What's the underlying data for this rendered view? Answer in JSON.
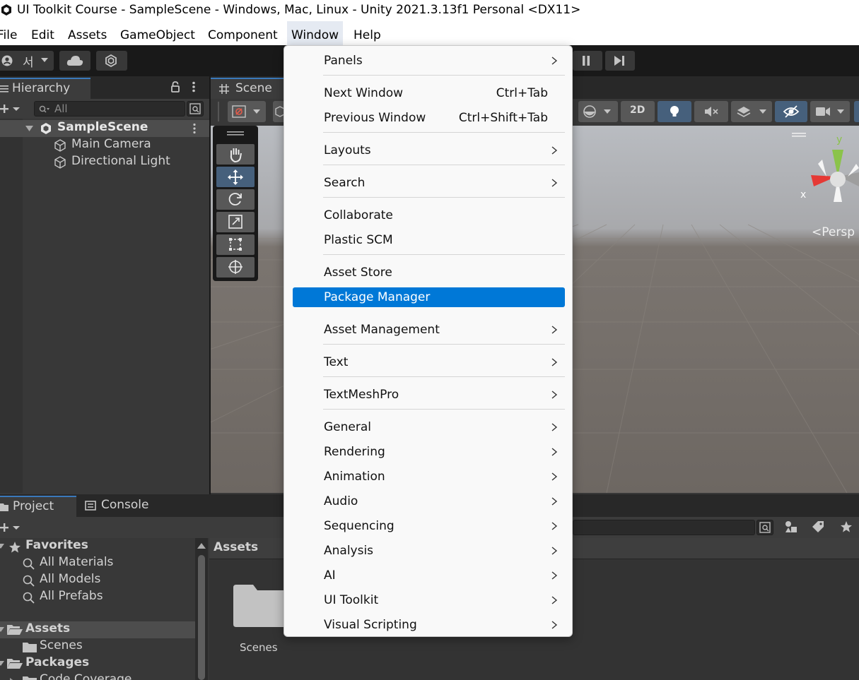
{
  "window": {
    "title": "UI Toolkit Course - SampleScene - Windows, Mac, Linux - Unity 2021.3.13f1 Personal <DX11>"
  },
  "menubar": {
    "items": [
      "File",
      "Edit",
      "Assets",
      "GameObject",
      "Component",
      "Window",
      "Help"
    ]
  },
  "toolbar": {
    "account_label": "서"
  },
  "hierarchy": {
    "tab_label": "Hierarchy",
    "search_placeholder": "All",
    "scene": "SampleScene",
    "objects": [
      "Main Camera",
      "Directional Light"
    ]
  },
  "scene": {
    "tab_label": "Scene",
    "mode_2d": "2D",
    "persp_label": "<Persp",
    "axis_x": "x",
    "axis_y": "y"
  },
  "project": {
    "tab_project": "Project",
    "tab_console": "Console",
    "favorites": "Favorites",
    "fav_items": [
      "All Materials",
      "All Models",
      "All Prefabs"
    ],
    "assets": "Assets",
    "assets_children": [
      "Scenes"
    ],
    "packages": "Packages",
    "packages_children": [
      "Code Coverage"
    ],
    "assets_header": "Assets",
    "folder_label": "Scenes"
  },
  "window_menu": {
    "items": [
      {
        "label": "Panels",
        "submenu": true
      },
      {
        "label": "Next Window",
        "shortcut": "Ctrl+Tab"
      },
      {
        "label": "Previous Window",
        "shortcut": "Ctrl+Shift+Tab"
      },
      {
        "label": "Layouts",
        "submenu": true
      },
      {
        "label": "Search",
        "submenu": true
      },
      {
        "label": "Collaborate"
      },
      {
        "label": "Plastic SCM"
      },
      {
        "label": "Asset Store"
      },
      {
        "label": "Package Manager",
        "highlighted": true
      },
      {
        "label": "Asset Management",
        "submenu": true
      },
      {
        "label": "Text",
        "submenu": true
      },
      {
        "label": "TextMeshPro",
        "submenu": true
      },
      {
        "label": "General",
        "submenu": true
      },
      {
        "label": "Rendering",
        "submenu": true
      },
      {
        "label": "Animation",
        "submenu": true
      },
      {
        "label": "Audio",
        "submenu": true
      },
      {
        "label": "Sequencing",
        "submenu": true
      },
      {
        "label": "Analysis",
        "submenu": true
      },
      {
        "label": "AI",
        "submenu": true
      },
      {
        "label": "UI Toolkit",
        "submenu": true
      },
      {
        "label": "Visual Scripting",
        "submenu": true
      }
    ]
  },
  "colors": {
    "highlight": "#0078d7",
    "accent_tab": "#3a79bb",
    "active_tool": "#46607c"
  }
}
